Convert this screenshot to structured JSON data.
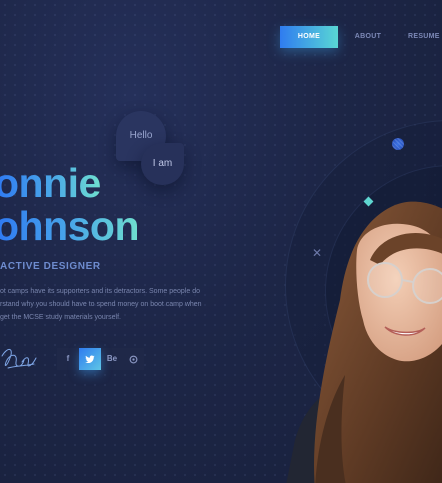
{
  "nav": {
    "home": "HOME",
    "about": "ABOUT",
    "resume": "RESUME"
  },
  "bubbles": {
    "hello": "Hello",
    "iam": "I am"
  },
  "hero": {
    "name_line1": "onnie",
    "name_line2": "ohnson",
    "role": "ACTIVE DESIGNER",
    "bio_lines": [
      "ot camps have its supporters and its detractors. Some people do",
      "rstand why you should have to spend money on boot camp when",
      "get the MCSE study materials yourself."
    ]
  },
  "social": {
    "facebook": "f",
    "behance": "Be"
  },
  "icons": {
    "twitter": "twitter-icon",
    "github": "github-icon",
    "facebook": "facebook-icon",
    "behance": "behance-icon"
  },
  "colors": {
    "accent_start": "#2f7cf0",
    "accent_end": "#59d7d4",
    "background": "#1c2440"
  }
}
